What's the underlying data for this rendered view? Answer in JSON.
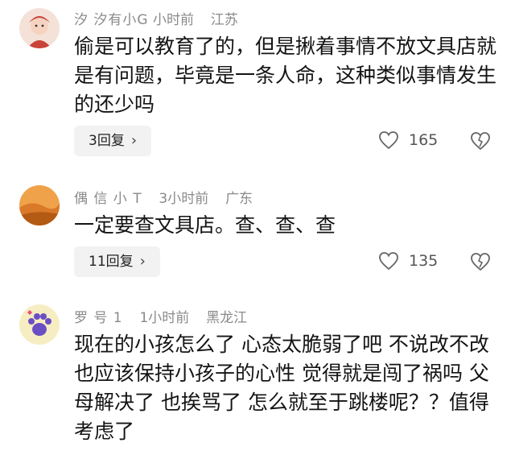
{
  "comments": [
    {
      "username": "汐 汐有小G",
      "time": "小时前",
      "location": "江苏",
      "text": "偷是可以教育了的，但是揪着事情不放文具店就是有问题，毕竟是一条人命，这种类似事情发生的还少吗",
      "replies_label": "3回复",
      "likes": "165",
      "avatar_icon": "baby-avatar-red",
      "avatar_colors": [
        "#c8433a",
        "#f4e1d8"
      ]
    },
    {
      "username": "偶 信 小 T",
      "time": "3小时前",
      "location": "广东",
      "text": "一定要查文具店。查、查、查",
      "replies_label": "11回复",
      "likes": "135",
      "avatar_icon": "desert-avatar",
      "avatar_colors": [
        "#e08a2e",
        "#b35a14"
      ]
    },
    {
      "username": "罗 号 1",
      "time": "1小时前",
      "location": "黑龙江",
      "text": "现在的小孩怎么了 心态太脆弱了吧 不说改不改 也应该保持小孩子的心性 觉得就是闯了祸吗 父母解决了 也挨骂了 怎么就至于跳楼呢？？值得考虑了",
      "avatar_icon": "paw-avatar",
      "avatar_colors": [
        "#f6edc2",
        "#6a4fc4"
      ]
    }
  ]
}
